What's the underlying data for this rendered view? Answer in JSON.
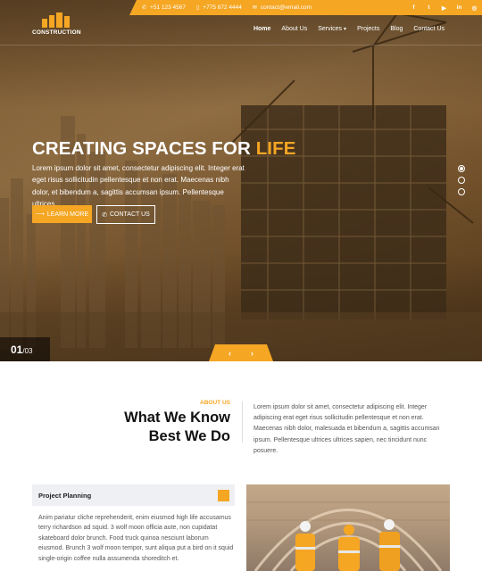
{
  "topbar": {
    "phone1": "+51 123 4567",
    "phone2": "+775 872 4444",
    "email": "contact@email.com",
    "social": [
      {
        "icon": "facebook-icon",
        "glyph": "f"
      },
      {
        "icon": "twitter-icon",
        "glyph": "t"
      },
      {
        "icon": "youtube-icon",
        "glyph": "▶"
      },
      {
        "icon": "linkedin-icon",
        "glyph": "in"
      },
      {
        "icon": "instagram-icon",
        "glyph": "◎"
      }
    ]
  },
  "brand": {
    "name": "CONSTRUCTION"
  },
  "nav": {
    "home": "Home",
    "about": "About Us",
    "services": "Services",
    "projects": "Projects",
    "blog": "Blog",
    "contact": "Contact Us"
  },
  "hero": {
    "title_main": "CREATING SPACES FOR ",
    "title_accent": "LIFE",
    "text": "Lorem ipsum dolor sit amet, consectetur adipiscing elit. Integer erat eget risus sollicitudin pellentesque et non erat. Maecenas nibh dolor, et bibendum a, sagittis accumsan ipsum. Pellentesque ultrices.",
    "btn_primary": "LEARN MORE",
    "btn_secondary": "CONTACT US",
    "slide_current": "01",
    "slide_total": "/03"
  },
  "about": {
    "tag": "ABOUT US",
    "heading_line1": "What We Know",
    "heading_line2": "Best We Do",
    "text": "Lorem ipsum dolor sit amet, consectetur adipiscing elit. Integer adipiscing erat eget risus sollicitudin pellentesque et non erat. Maecenas nibh dolor, malesuada et bibendum a, sagittis accumsan ipsum. Pellentesque ultrices ultrices sapien, nec tincidunt nunc posuere."
  },
  "service": {
    "title": "Project Planning",
    "text": "Anim pariatur cliche reprehenderit, enim eiusmod high life accusamus terry richardson ad squid. 3 wolf moon officia aute, non cupidatat skateboard dolor brunch. Food truck quinoa nesciunt laborum eiusmod. Brunch 3 wolf moon tempor, sunt aliqua put a bird on it squid single-origin coffee nulla assumenda shoreditch et."
  },
  "colors": {
    "accent": "#f5a623"
  }
}
